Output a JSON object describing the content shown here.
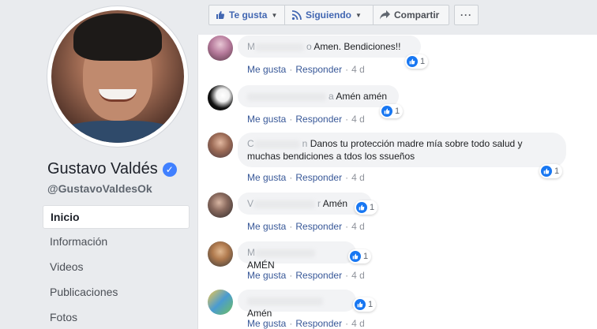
{
  "profile": {
    "name": "Gustavo Valdés",
    "handle": "@GustavoValdesOk"
  },
  "nav": [
    {
      "label": "Inicio"
    },
    {
      "label": "Información"
    },
    {
      "label": "Videos"
    },
    {
      "label": "Publicaciones"
    },
    {
      "label": "Fotos"
    }
  ],
  "actions": {
    "like": "Te gusta",
    "follow": "Siguiendo",
    "share": "Compartir",
    "more": "···"
  },
  "colors": {
    "accent": "#4267b2",
    "link": "#385898",
    "verified": "#4080ff"
  },
  "comment_actions": {
    "like": "Me gusta",
    "reply": "Responder",
    "separator": "·"
  },
  "comments": [
    {
      "prefix": "M",
      "tail": "o",
      "text": "Amen. Bendiciones!!",
      "likes": "1",
      "time": "4 d"
    },
    {
      "prefix": "",
      "tail": "a",
      "text": "Amén amén",
      "likes": "1",
      "time": "4 d"
    },
    {
      "prefix": "C",
      "tail": "n",
      "text": "Danos tu protección madre mía sobre todo salud y",
      "text2": "muchas bendiciones a tdos los ssueños",
      "likes": "1",
      "time": "4 d"
    },
    {
      "prefix": "V",
      "tail": "r",
      "text": "Amén",
      "likes": "1",
      "time": "4 d"
    },
    {
      "prefix": "M",
      "tail": "",
      "text": "AMÉN",
      "likes": "1",
      "time": "4 d"
    },
    {
      "prefix": "",
      "tail": "",
      "text": "Amén",
      "likes": "1",
      "time": "4 d"
    }
  ]
}
